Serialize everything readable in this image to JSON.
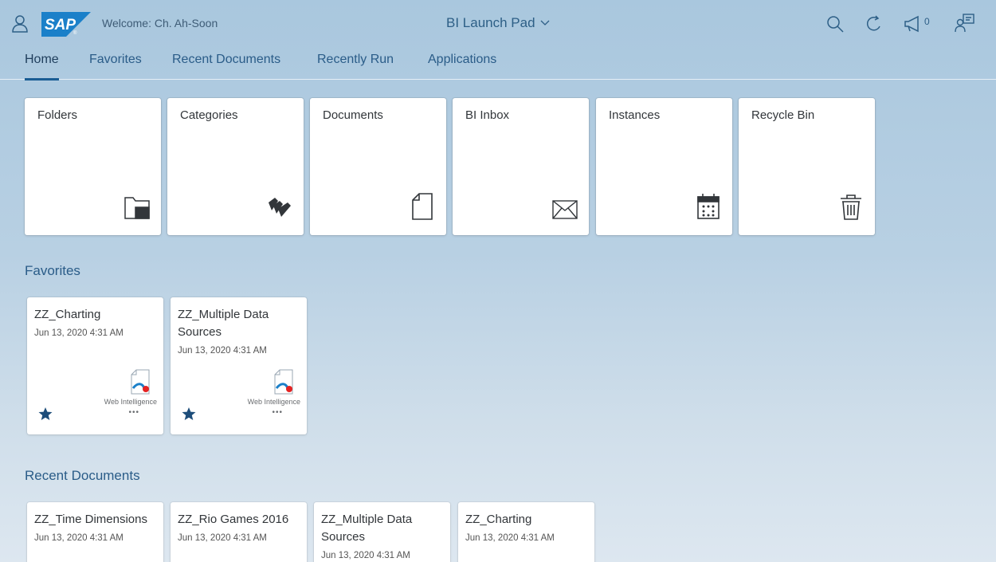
{
  "header": {
    "welcome": "Welcome: Ch. Ah-Soon",
    "app_title": "BI Launch Pad",
    "notification_count": "0",
    "logo_text": "SAP"
  },
  "tabs": [
    {
      "label": "Home",
      "active": true
    },
    {
      "label": "Favorites",
      "active": false
    },
    {
      "label": "Recent Documents",
      "active": false
    },
    {
      "label": "Recently Run",
      "active": false
    },
    {
      "label": "Applications",
      "active": false
    }
  ],
  "tiles": [
    {
      "label": "Folders",
      "icon": "folder-icon"
    },
    {
      "label": "Categories",
      "icon": "categories-icon"
    },
    {
      "label": "Documents",
      "icon": "document-icon"
    },
    {
      "label": "BI Inbox",
      "icon": "envelope-icon"
    },
    {
      "label": "Instances",
      "icon": "calendar-icon"
    },
    {
      "label": "Recycle Bin",
      "icon": "trash-icon"
    }
  ],
  "favorites": {
    "title": "Favorites",
    "items": [
      {
        "name": "ZZ_Charting",
        "date": "Jun 13, 2020 4:31 AM",
        "type": "Web Intelligence",
        "more": "•••"
      },
      {
        "name": "ZZ_Multiple Data Sources",
        "date": "Jun 13, 2020 4:31 AM",
        "type": "Web Intelligence",
        "more": "•••"
      }
    ]
  },
  "recent": {
    "title": "Recent Documents",
    "items": [
      {
        "name": "ZZ_Time Dimensions",
        "date": "Jun 13, 2020 4:31 AM"
      },
      {
        "name": "ZZ_Rio Games 2016",
        "date": "Jun 13, 2020 4:31 AM"
      },
      {
        "name": "ZZ_Multiple Data Sources",
        "date": "Jun 13, 2020 4:31 AM"
      },
      {
        "name": "ZZ_Charting",
        "date": "Jun 13, 2020 4:31 AM"
      }
    ]
  },
  "colors": {
    "brand_blue": "#1a5d94",
    "text": "#32363a",
    "link": "#2a5c88"
  }
}
